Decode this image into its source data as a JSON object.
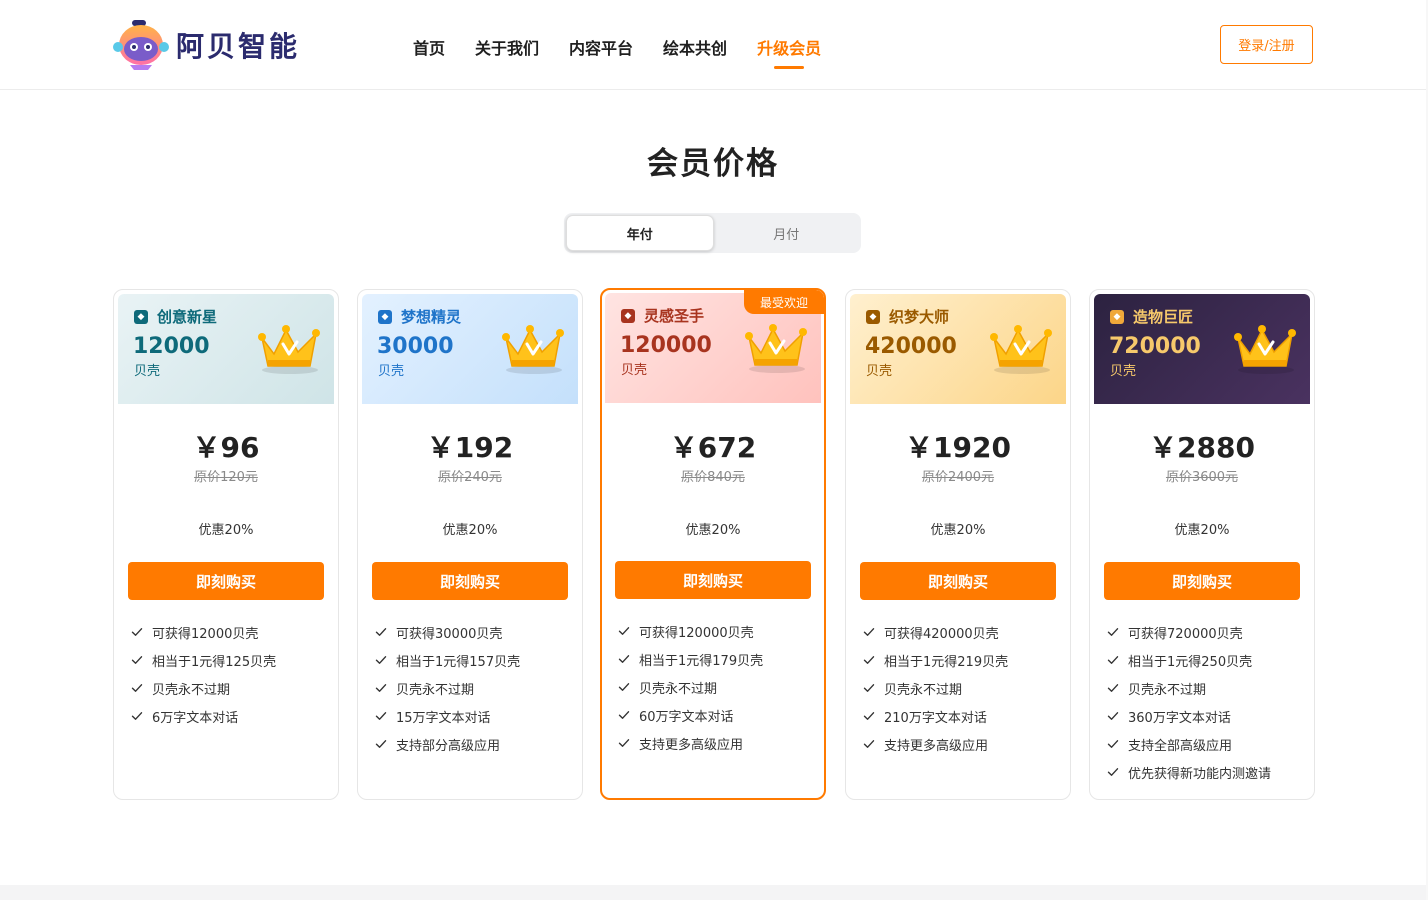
{
  "brand": {
    "name": "阿贝智能"
  },
  "nav": {
    "items": [
      {
        "label": "首页",
        "active": false
      },
      {
        "label": "关于我们",
        "active": false
      },
      {
        "label": "内容平台",
        "active": false
      },
      {
        "label": "绘本共创",
        "active": false
      },
      {
        "label": "升级会员",
        "active": true
      }
    ],
    "login_label": "登录/注册"
  },
  "title": "会员价格",
  "billing_toggle": {
    "options": [
      "年付",
      "月付"
    ],
    "selected": "年付"
  },
  "colors": {
    "accent": "#ff7a00"
  },
  "plans": [
    {
      "tier_name": "创意新星",
      "amount": "12000",
      "unit": "贝壳",
      "price": "￥96",
      "original_price": "原价120元",
      "discount": "优惠20%",
      "buy_label": "即刻购买",
      "badge": "",
      "banner_colors": [
        "#e9f3f5",
        "#cfe4e7"
      ],
      "text_color": "#0e6a7a",
      "features": [
        "可获得12000贝壳",
        "相当于1元得125贝壳",
        "贝壳永不过期",
        "6万字文本对话"
      ]
    },
    {
      "tier_name": "梦想精灵",
      "amount": "30000",
      "unit": "贝壳",
      "price": "￥192",
      "original_price": "原价240元",
      "discount": "优惠20%",
      "buy_label": "即刻购买",
      "badge": "",
      "banner_colors": [
        "#e3f1ff",
        "#c4e0fb"
      ],
      "text_color": "#1f74c9",
      "features": [
        "可获得30000贝壳",
        "相当于1元得157贝壳",
        "贝壳永不过期",
        "15万字文本对话",
        "支持部分高级应用"
      ]
    },
    {
      "tier_name": "灵感圣手",
      "amount": "120000",
      "unit": "贝壳",
      "price": "￥672",
      "original_price": "原价840元",
      "discount": "优惠20%",
      "buy_label": "即刻购买",
      "badge": "最受欢迎",
      "banner_colors": [
        "#ffe4e2",
        "#ffc2bd"
      ],
      "text_color": "#a8341f",
      "features": [
        "可获得120000贝壳",
        "相当于1元得179贝壳",
        "贝壳永不过期",
        "60万字文本对话",
        "支持更多高级应用"
      ]
    },
    {
      "tier_name": "织梦大师",
      "amount": "420000",
      "unit": "贝壳",
      "price": "￥1920",
      "original_price": "原价2400元",
      "discount": "优惠20%",
      "buy_label": "即刻购买",
      "badge": "",
      "banner_colors": [
        "#fff0cf",
        "#fcd588"
      ],
      "text_color": "#9a5a00",
      "features": [
        "可获得420000贝壳",
        "相当于1元得219贝壳",
        "贝壳永不过期",
        "210万字文本对话",
        "支持更多高级应用"
      ]
    },
    {
      "tier_name": "造物巨匠",
      "amount": "720000",
      "unit": "贝壳",
      "price": "￥2880",
      "original_price": "原价3600元",
      "discount": "优惠20%",
      "buy_label": "即刻购买",
      "badge": "",
      "banner_colors": [
        "#2c2240",
        "#4a3260"
      ],
      "text_color": "#f7c96b",
      "features": [
        "可获得720000贝壳",
        "相当于1元得250贝壳",
        "贝壳永不过期",
        "360万字文本对话",
        "支持全部高级应用",
        "优先获得新功能内测邀请"
      ]
    }
  ]
}
